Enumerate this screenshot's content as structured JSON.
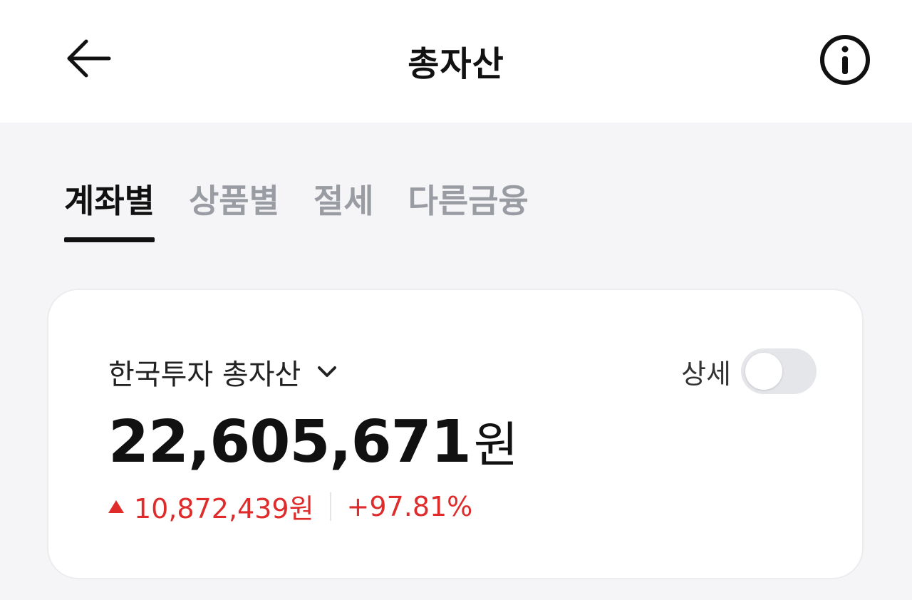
{
  "header": {
    "title": "총자산",
    "back_icon": "arrow-left-icon",
    "info_icon": "info-circle-icon"
  },
  "tabs": [
    {
      "label": "계좌별",
      "active": true
    },
    {
      "label": "상품별",
      "active": false
    },
    {
      "label": "절세",
      "active": false
    },
    {
      "label": "다른금융",
      "active": false
    }
  ],
  "card": {
    "account_name": "한국투자 총자산",
    "dropdown_icon": "chevron-down-icon",
    "detail_label": "상세",
    "detail_toggle_on": false,
    "total_amount": "22,605,671",
    "total_unit": "원",
    "change_icon": "triangle-up-icon",
    "change_amount": "10,872,439원",
    "change_rate": "+97.81%"
  },
  "colors": {
    "background": "#f5f5f7",
    "card_background": "#ffffff",
    "positive": "#e02b2b",
    "inactive_tab": "#9a9ca3",
    "toggle_off": "#e5e6ea"
  }
}
